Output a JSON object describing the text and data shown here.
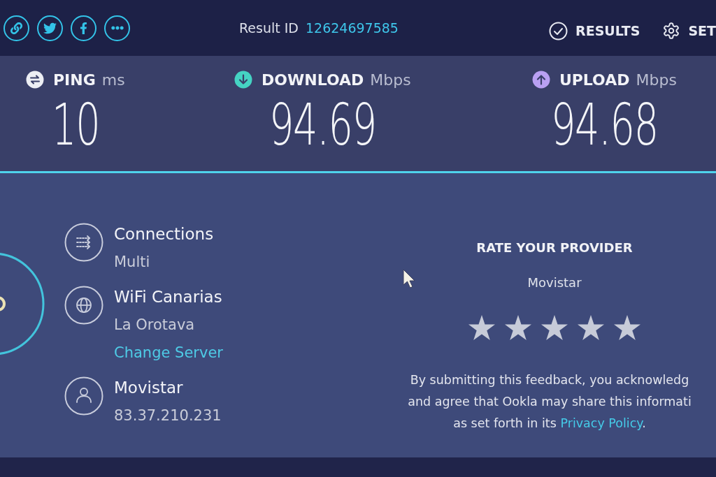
{
  "top_bar": {
    "result_id_label": "Result ID",
    "result_id": "12624697585",
    "nav": [
      {
        "kind": "results",
        "label": "RESULTS"
      },
      {
        "kind": "settings",
        "label": "SET"
      }
    ]
  },
  "metrics": [
    {
      "kind": "ping",
      "name": "PING",
      "unit": "ms",
      "value": "10"
    },
    {
      "kind": "download",
      "name": "DOWNLOAD",
      "unit": "Mbps",
      "value": "94.69"
    },
    {
      "kind": "upload",
      "name": "UPLOAD",
      "unit": "Mbps",
      "value": "94.68"
    }
  ],
  "details": [
    {
      "kind": "connections",
      "title": "Connections",
      "subtitle": "Multi"
    },
    {
      "kind": "server",
      "title": "WiFi Canarias",
      "subtitle": "La Orotava",
      "link": "Change Server"
    },
    {
      "kind": "isp",
      "title": "Movistar",
      "subtitle": "83.37.210.231"
    }
  ],
  "rating": {
    "title": "RATE YOUR PROVIDER",
    "provider": "Movistar",
    "stars": 5,
    "disclaimer_lines": [
      "By submitting this feedback, you acknowledg",
      "and agree that Ookla may share this informati",
      "as set forth in its"
    ],
    "policy_link": "Privacy Policy",
    "disclaimer_end": "."
  }
}
